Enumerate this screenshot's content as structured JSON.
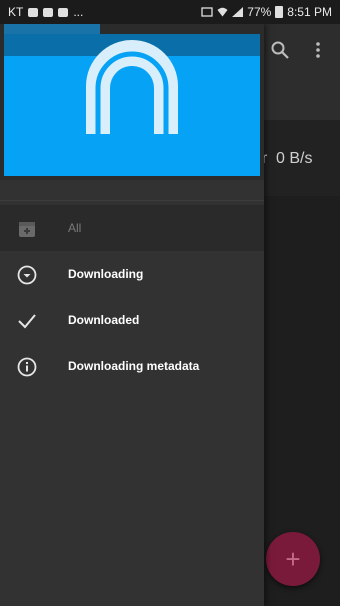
{
  "status_bar": {
    "carrier": "KT",
    "more": "...",
    "battery": "77%",
    "time": "8:51 PM"
  },
  "app": {
    "speed": "0 B/s",
    "speed_prefix": "r",
    "fab_label": "+"
  },
  "drawer": {
    "menu": [
      {
        "label": "All",
        "icon": "all-icon",
        "selected": true
      },
      {
        "label": "Downloading",
        "icon": "downloading-icon",
        "selected": false
      },
      {
        "label": "Downloaded",
        "icon": "check-icon",
        "selected": false
      },
      {
        "label": "Downloading metadata",
        "icon": "info-icon",
        "selected": false
      }
    ]
  },
  "colors": {
    "header_blue": "#06a2f5",
    "fab": "#7a1a3a",
    "drawer_bg": "#323232"
  }
}
